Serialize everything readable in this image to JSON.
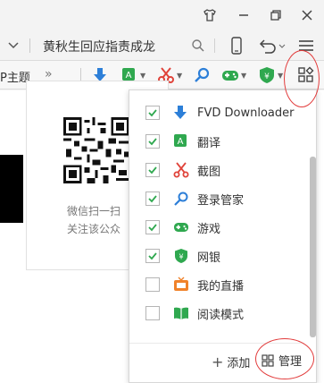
{
  "titlebar": {
    "shirt_icon": "shirt-icon",
    "minimize_icon": "minimize-icon",
    "restore_icon": "restore-icon",
    "close_icon": "close-icon"
  },
  "address": {
    "search_text": "黄秋生回应指责成龙",
    "search_icon": "search-icon",
    "phone_icon": "phone-icon",
    "undo_icon": "undo-icon",
    "menu_icon": "menu-icon"
  },
  "toolbar": {
    "theme_label": "P主题",
    "more_label": "»"
  },
  "page": {
    "qr_line1": "微信扫一扫",
    "qr_line2": "关注该公众"
  },
  "dropdown": {
    "items": [
      {
        "label": "FVD Downloader",
        "checked": true,
        "icon": "download-icon"
      },
      {
        "label": "翻译",
        "checked": true,
        "icon": "translate-icon"
      },
      {
        "label": "截图",
        "checked": true,
        "icon": "scissors-icon"
      },
      {
        "label": "登录管家",
        "checked": true,
        "icon": "key-icon"
      },
      {
        "label": "游戏",
        "checked": true,
        "icon": "gamepad-icon"
      },
      {
        "label": "网银",
        "checked": true,
        "icon": "bank-shield-icon"
      },
      {
        "label": "我的直播",
        "checked": false,
        "icon": "tv-icon"
      },
      {
        "label": "阅读模式",
        "checked": false,
        "icon": "book-icon"
      }
    ],
    "add_label": "添加",
    "manage_label": "管理"
  },
  "colors": {
    "check_green": "#2fa84f",
    "accent_blue": "#2d7fd8",
    "highlight_red": "#e23b3b",
    "orange": "#f0822a"
  }
}
